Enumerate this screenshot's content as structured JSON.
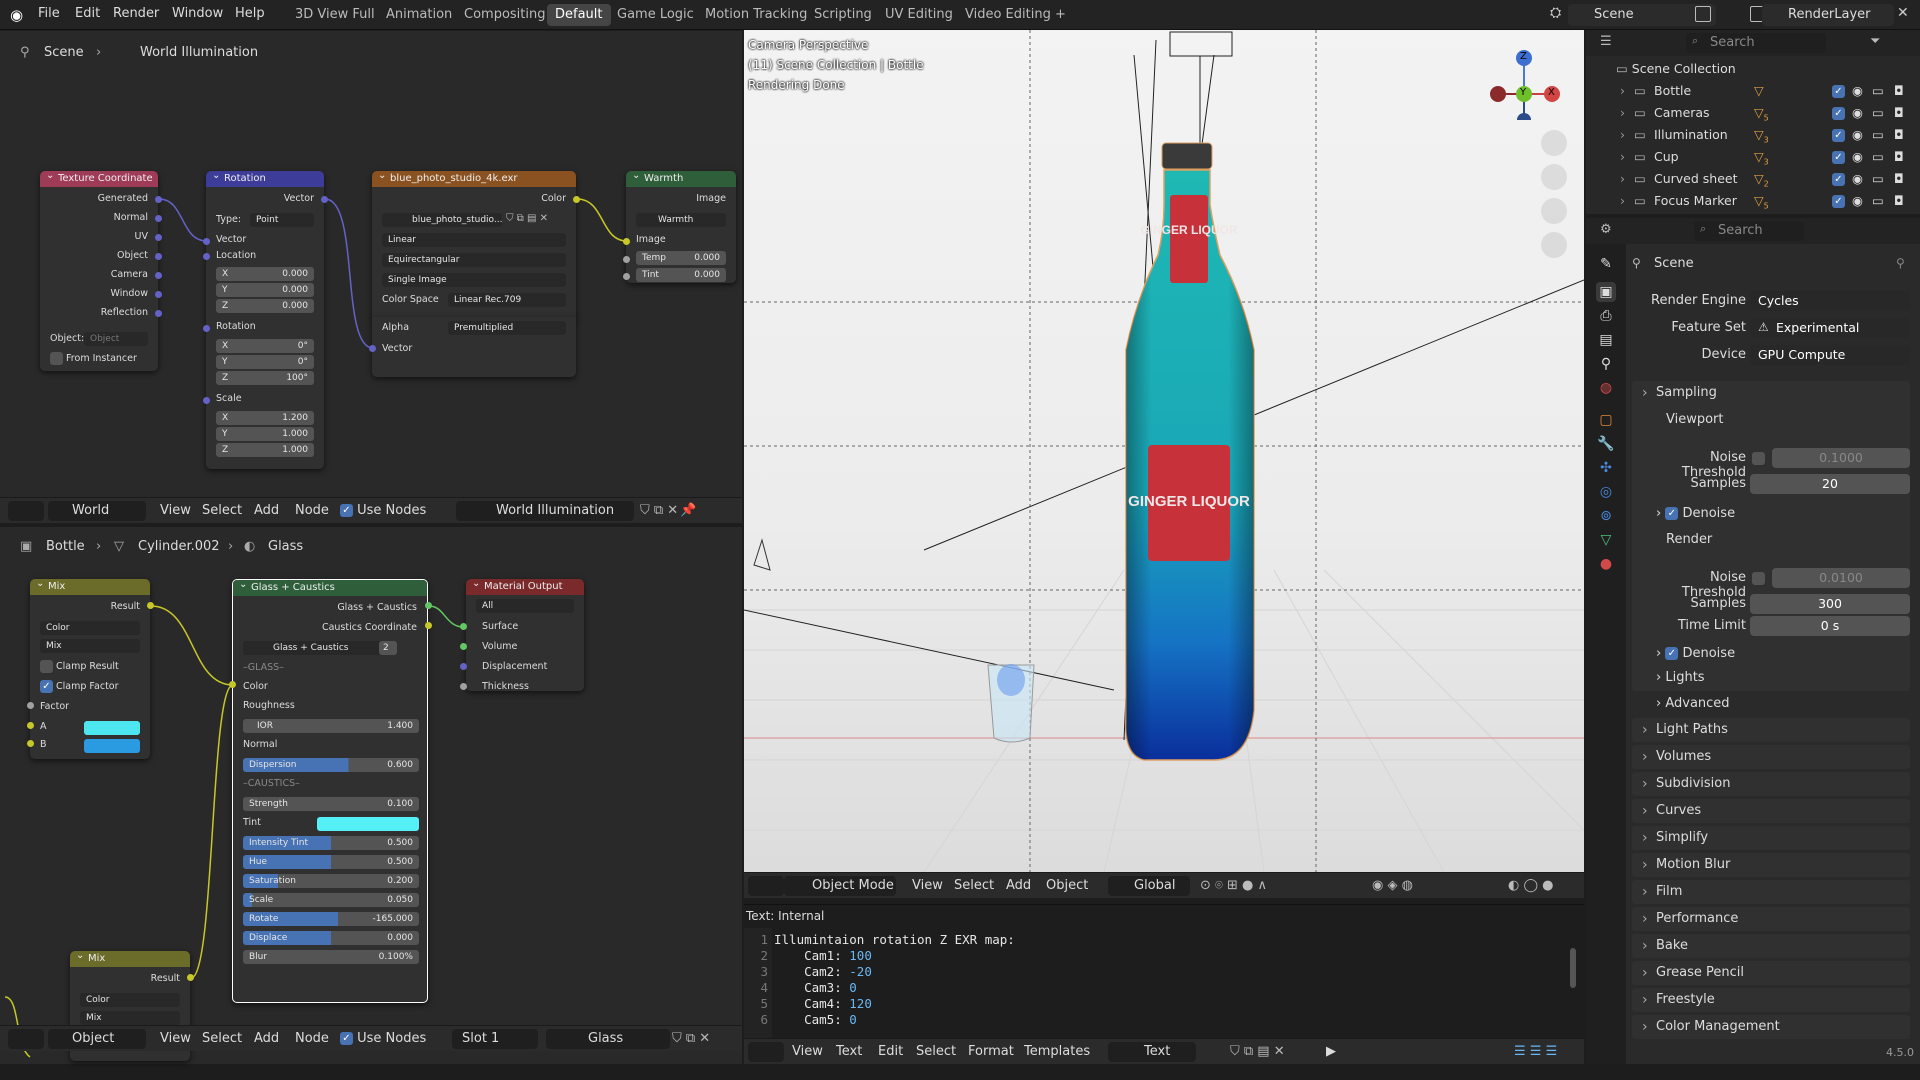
{
  "topbar": {
    "menus": [
      "File",
      "Edit",
      "Render",
      "Window",
      "Help"
    ],
    "workspaces": [
      "3D View Full",
      "Animation",
      "Compositing",
      "Default",
      "Game Logic",
      "Motion Tracking",
      "Scripting",
      "UV Editing",
      "Video Editing"
    ],
    "active_workspace": "Default",
    "add_tab": "+",
    "scene_name": "Scene",
    "view_layer": "RenderLayer"
  },
  "world_editor": {
    "breadcrumb": [
      "Scene",
      "World Illumination"
    ],
    "nodes": {
      "texcoord": {
        "title": "Texture Coordinate",
        "outputs": [
          "Generated",
          "Normal",
          "UV",
          "Object",
          "Camera",
          "Window",
          "Reflection"
        ],
        "object_label": "Object:",
        "object_placeholder": "Object",
        "from_instancer": "From Instancer"
      },
      "rotation": {
        "title": "Rotation",
        "out": "Vector",
        "type_label": "Type:",
        "type_value": "Point",
        "in_vector": "Vector",
        "location": "Location",
        "loc": [
          [
            "X",
            "0.000"
          ],
          [
            "Y",
            "0.000"
          ],
          [
            "Z",
            "0.000"
          ]
        ],
        "rotation": "Rotation",
        "rot": [
          [
            "X",
            "0°"
          ],
          [
            "Y",
            "0°"
          ],
          [
            "Z",
            "100°"
          ]
        ],
        "scale": "Scale",
        "scl": [
          [
            "X",
            "1.200"
          ],
          [
            "Y",
            "1.000"
          ],
          [
            "Z",
            "1.000"
          ]
        ]
      },
      "envtex": {
        "title": "blue_photo_studio_4k.exr",
        "out": "Color",
        "image_name": "blue_photo_studio...",
        "interp": "Linear",
        "proj": "Equirectangular",
        "source": "Single Image",
        "cs_label": "Color Space",
        "cs_value": "Linear Rec.709",
        "alpha_label": "Alpha",
        "alpha_value": "Premultiplied",
        "in_vector": "Vector"
      },
      "warmth": {
        "title": "Warmth",
        "out": "Image",
        "group": "Warmth",
        "in_image": "Image",
        "temp": [
          "Temp",
          "0.000"
        ],
        "tint": [
          "Tint",
          "0.000"
        ]
      }
    },
    "header": {
      "editor_type": "World",
      "menus": [
        "View",
        "Select",
        "Add",
        "Node"
      ],
      "use_nodes": "Use Nodes",
      "world_name": "World Illumination"
    }
  },
  "material_editor": {
    "breadcrumb": [
      "Bottle",
      "Cylinder.002",
      "Glass"
    ],
    "nodes": {
      "mix1": {
        "title": "Mix",
        "out": "Result",
        "type": "Color",
        "blend": "Mix",
        "clamp_result": "Clamp Result",
        "clamp_factor": "Clamp Factor",
        "factor": "Factor",
        "a": "A",
        "b": "B",
        "a_color": "#4de6f0",
        "b_color": "#2a9be0"
      },
      "glass": {
        "title": "Glass + Caustics",
        "outputs": [
          "Glass + Caustics",
          "Caustics Coordinate"
        ],
        "group": "Glass + Caustics",
        "users": "2",
        "sec_glass": "–GLASS–",
        "color": "Color",
        "roughness": "Roughness",
        "ior": [
          "IOR",
          "1.400"
        ],
        "normal": "Normal",
        "dispersion": [
          "Dispersion",
          "0.600"
        ],
        "sec_caustics": "–CAUSTICS–",
        "strength": [
          "Strength",
          "0.100"
        ],
        "tint": "Tint",
        "tint_color": "#55f0f5",
        "intensity_tint": [
          "Intensity Tint",
          "0.500"
        ],
        "hue": [
          "Hue",
          "0.500"
        ],
        "saturation": [
          "Saturation",
          "0.200"
        ],
        "scale": [
          "Scale",
          "0.050"
        ],
        "rotate": [
          "Rotate",
          "-165.000"
        ],
        "displace": [
          "Displace",
          "0.000"
        ],
        "blur": [
          "Blur",
          "0.100%"
        ],
        "fills": {
          "dispersion": 0.6,
          "intensity_tint": 0.5,
          "hue": 0.5,
          "saturation": 0.2,
          "rotate": 0.54,
          "displace": 0.5,
          "scale": 0.05
        }
      },
      "matout": {
        "title": "Material Output",
        "target": "All",
        "inputs": [
          "Surface",
          "Volume",
          "Displacement",
          "Thickness"
        ]
      },
      "mix2": {
        "title": "Mix",
        "out": "Result",
        "type": "Color",
        "blend": "Mix"
      }
    },
    "header": {
      "editor_type": "Object",
      "menus": [
        "View",
        "Select",
        "Add",
        "Node"
      ],
      "use_nodes": "Use Nodes",
      "slot": "Slot 1",
      "material": "Glass"
    }
  },
  "viewport": {
    "overlay": [
      "Camera Perspective",
      "(11) Scene Collection | Bottle",
      "Rendering Done"
    ],
    "label_top": "GINGER LIQUOR",
    "label_main": "GINGER LIQUOR",
    "header": {
      "mode": "Object Mode",
      "menus": [
        "View",
        "Select",
        "Add",
        "Object"
      ],
      "orientation": "Global"
    },
    "gizmo": {
      "z": "Z",
      "y": "Y",
      "x": "X"
    }
  },
  "text_editor": {
    "title": "Text: Internal",
    "lines": [
      {
        "n": "1",
        "code": "Illumintaion rotation Z EXR map:",
        "val": ""
      },
      {
        "n": "2",
        "code": "    Cam1: ",
        "val": "100"
      },
      {
        "n": "3",
        "code": "    Cam2: ",
        "val": "-20"
      },
      {
        "n": "4",
        "code": "    Cam3: ",
        "val": "0"
      },
      {
        "n": "5",
        "code": "    Cam4: ",
        "val": "120"
      },
      {
        "n": "6",
        "code": "    Cam5: ",
        "val": "0"
      }
    ],
    "header": {
      "menus": [
        "View",
        "Text",
        "Edit",
        "Select",
        "Format",
        "Templates"
      ],
      "text_name": "Text"
    }
  },
  "outliner": {
    "search_placeholder": "Search",
    "root": "Scene Collection",
    "items": [
      {
        "name": "Bottle",
        "badge": ""
      },
      {
        "name": "Cameras",
        "badge": "5"
      },
      {
        "name": "Illumination",
        "badge": "3"
      },
      {
        "name": "Cup",
        "badge": "3"
      },
      {
        "name": "Curved sheet",
        "badge": "2"
      },
      {
        "name": "Focus Marker",
        "badge": "5"
      }
    ]
  },
  "properties": {
    "search_placeholder": "Search",
    "context": "Scene",
    "render_engine_label": "Render Engine",
    "render_engine": "Cycles",
    "feature_set_label": "Feature Set",
    "feature_set": "Experimental",
    "device_label": "Device",
    "device": "GPU Compute",
    "sampling": "Sampling",
    "viewport": "Viewport",
    "vp_noise_label": "Noise Threshold",
    "vp_noise": "0.1000",
    "vp_samples_label": "Samples",
    "vp_samples": "20",
    "denoise": "Denoise",
    "render": "Render",
    "r_noise_label": "Noise Threshold",
    "r_noise": "0.0100",
    "r_samples_label": "Samples",
    "r_samples": "300",
    "time_limit_label": "Time Limit",
    "time_limit": "0 s",
    "denoise2": "Denoise",
    "lights": "Lights",
    "advanced": "Advanced",
    "panels": [
      "Light Paths",
      "Volumes",
      "Subdivision",
      "Curves",
      "Simplify",
      "Motion Blur",
      "Film",
      "Performance",
      "Bake",
      "Grease Pencil",
      "Freestyle",
      "Color Management"
    ]
  },
  "version": "4.5.0"
}
